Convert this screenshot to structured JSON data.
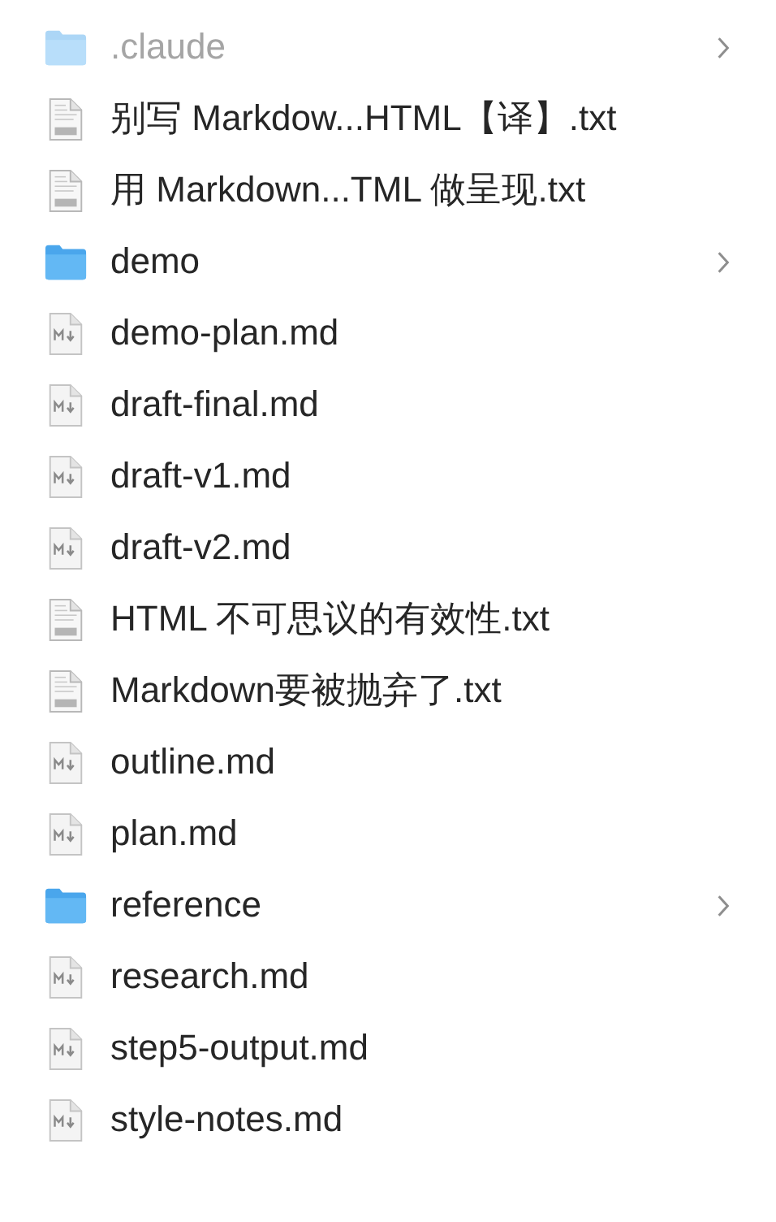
{
  "files": [
    {
      "name": ".claude",
      "kind": "folder",
      "hidden": true
    },
    {
      "name": "别写 Markdow...HTML【译】.txt",
      "kind": "txt",
      "hidden": false
    },
    {
      "name": "用 Markdown...TML 做呈现.txt",
      "kind": "txt",
      "hidden": false
    },
    {
      "name": "demo",
      "kind": "folder",
      "hidden": false
    },
    {
      "name": "demo-plan.md",
      "kind": "md",
      "hidden": false
    },
    {
      "name": "draft-final.md",
      "kind": "md",
      "hidden": false
    },
    {
      "name": "draft-v1.md",
      "kind": "md",
      "hidden": false
    },
    {
      "name": "draft-v2.md",
      "kind": "md",
      "hidden": false
    },
    {
      "name": "HTML 不可思议的有效性.txt",
      "kind": "txt",
      "hidden": false
    },
    {
      "name": "Markdown要被抛弃了.txt",
      "kind": "txt",
      "hidden": false
    },
    {
      "name": "outline.md",
      "kind": "md",
      "hidden": false
    },
    {
      "name": "plan.md",
      "kind": "md",
      "hidden": false
    },
    {
      "name": "reference",
      "kind": "folder",
      "hidden": false
    },
    {
      "name": "research.md",
      "kind": "md",
      "hidden": false
    },
    {
      "name": "step5-output.md",
      "kind": "md",
      "hidden": false
    },
    {
      "name": "style-notes.md",
      "kind": "md",
      "hidden": false
    }
  ]
}
